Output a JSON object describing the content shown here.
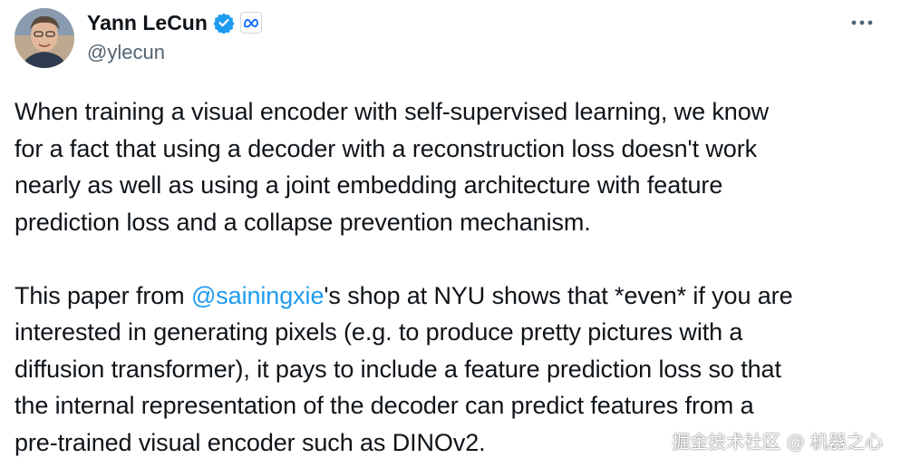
{
  "author": {
    "display_name": "Yann LeCun",
    "handle": "@ylecun",
    "verified_icon": "verified-badge-icon",
    "affiliation_icon": "meta-logo-icon"
  },
  "more_icon": "more-options-icon",
  "tweet": {
    "paragraph_1": "When training a visual encoder with self-supervised learning, we know\nfor a fact that using a decoder with a reconstruction loss doesn't work\nnearly as well as using a joint embedding architecture with feature\nprediction loss and a collapse prevention mechanism.",
    "paragraph_2_before": "This paper from ",
    "paragraph_2_mention": "@sainingxie",
    "paragraph_2_after": "'s shop at NYU shows that *even* if you are\ninterested in generating pixels (e.g. to produce pretty pictures with a\ndiffusion transformer), it pays to include a feature prediction loss so that\nthe internal representation of the decoder can predict features from a\npre-trained visual encoder such as DINOv2."
  },
  "watermark": "掘金技术社区 @ 机器之心",
  "colors": {
    "text": "#0f1419",
    "secondary": "#536471",
    "link": "#1d9bf0",
    "verified": "#1d9bf0"
  }
}
